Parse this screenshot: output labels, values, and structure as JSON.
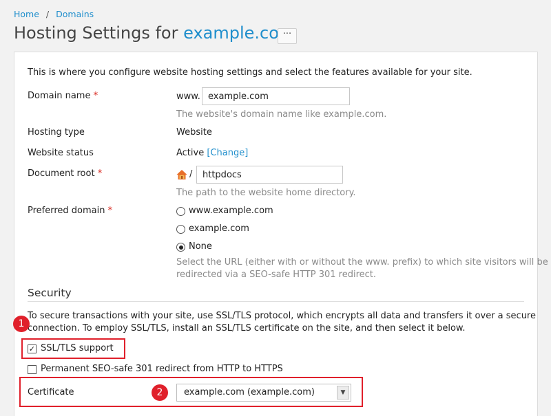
{
  "breadcrumb": {
    "home": "Home",
    "separator": "/",
    "domains": "Domains"
  },
  "page": {
    "title_prefix": "Hosting Settings for",
    "title_domain": "example.com",
    "more_label": "···"
  },
  "intro": "This is where you configure website hosting settings and select the features available for your site.",
  "domain_name": {
    "label": "Domain name",
    "required": "*",
    "prefix": "www.",
    "value": "example.com",
    "hint": "The website's domain name like example.com."
  },
  "hosting_type": {
    "label": "Hosting type",
    "value": "Website"
  },
  "website_status": {
    "label": "Website status",
    "value": "Active",
    "change_link": "[Change]"
  },
  "document_root": {
    "label": "Document root",
    "required": "*",
    "separator": "/",
    "value": "httpdocs",
    "hint": "The path to the website home directory."
  },
  "preferred_domain": {
    "label": "Preferred domain",
    "required": "*",
    "options": [
      "www.example.com",
      "example.com",
      "None"
    ],
    "selected": "None",
    "hint_line1": "Select the URL (either with or without the www. prefix) to which site visitors will be",
    "hint_line2": "redirected via a SEO-safe HTTP 301 redirect."
  },
  "security": {
    "title": "Security",
    "text_line1": "To secure transactions with your site, use SSL/TLS protocol, which encrypts all data and transfers it over a secure",
    "text_line2": "connection. To employ SSL/TLS, install an SSL/TLS certificate on the site, and then select it below.",
    "ssl_support": {
      "label": "SSL/TLS support",
      "checked": true,
      "mark": "✓"
    },
    "redirect_https": {
      "label": "Permanent SEO-safe 301 redirect from HTTP to HTTPS",
      "checked": false
    },
    "certificate": {
      "label": "Certificate",
      "value": "example.com (example.com)",
      "arrow": "▼"
    }
  },
  "annotations": {
    "badge1": "1",
    "badge2": "2",
    "color": "#e0202b"
  }
}
